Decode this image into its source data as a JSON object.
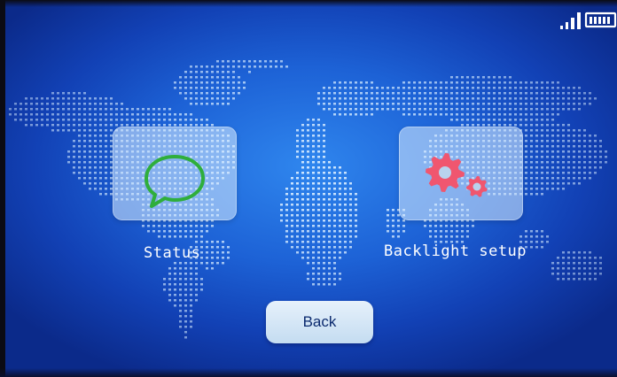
{
  "screen": {
    "background_color": "#1d62d6",
    "tiles": [
      {
        "label": "Status",
        "icon": "speech-bubble-icon",
        "icon_color": "#2fae3c"
      },
      {
        "label": "Backlight setup",
        "icon": "gears-icon",
        "icon_color": "#f0566f"
      }
    ],
    "back_button": {
      "label": "Back"
    },
    "status_bar": {
      "signal_icon": "signal-strength-icon",
      "battery_icon": "battery-icon"
    }
  }
}
